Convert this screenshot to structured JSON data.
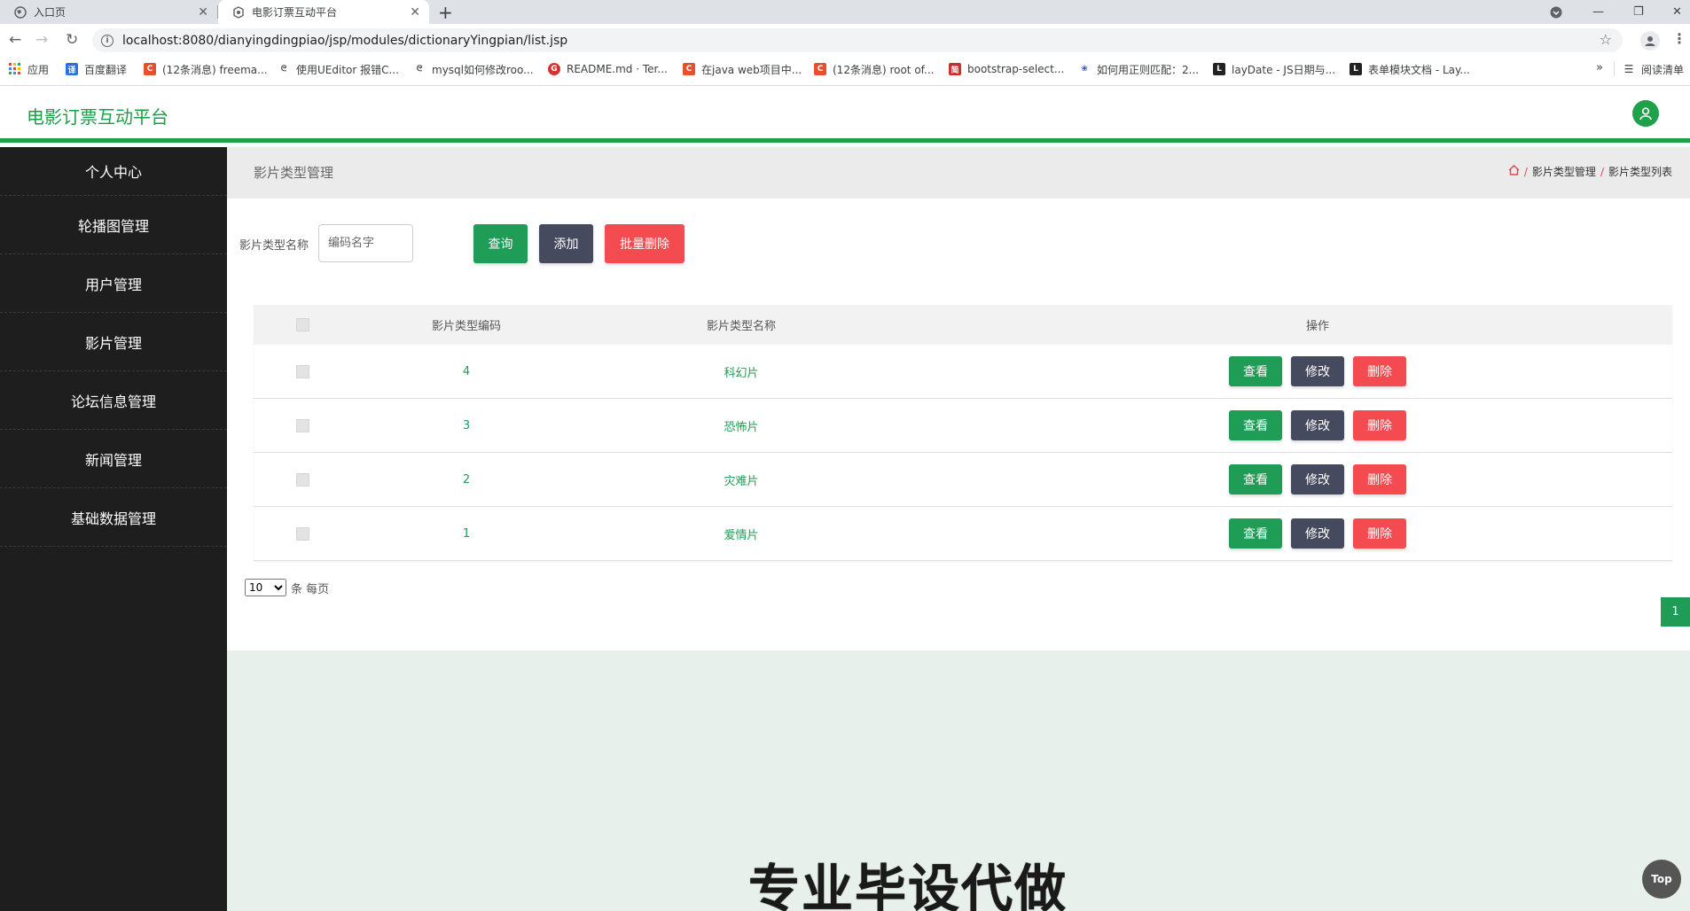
{
  "browser": {
    "tabs": [
      {
        "title": "入口页",
        "active": false
      },
      {
        "title": "电影订票互动平台",
        "active": true
      }
    ],
    "url": "localhost:8080/dianyingdingpiao/jsp/modules/dictionaryYingpian/list.jsp",
    "bookmarks": [
      {
        "label": "应用",
        "color": "#e8453c",
        "icon": "apps-grid-icon"
      },
      {
        "label": "百度翻译",
        "color": "#2b6fe0",
        "icon": "baidu-translate-icon"
      },
      {
        "label": "(12条消息) freema...",
        "color": "#e84f2c",
        "icon": "csdn-icon"
      },
      {
        "label": "使用UEditor 报错C...",
        "color": "#333333",
        "icon": "blog-icon"
      },
      {
        "label": "mysql如何修改roo...",
        "color": "#333333",
        "icon": "blog-icon"
      },
      {
        "label": "README.md · Ter...",
        "color": "#d6322f",
        "icon": "gitee-icon"
      },
      {
        "label": "在java web项目中...",
        "color": "#e84f2c",
        "icon": "csdn-icon"
      },
      {
        "label": "(12条消息) root of...",
        "color": "#e84f2c",
        "icon": "csdn-icon"
      },
      {
        "label": "bootstrap-select...",
        "color": "#c6312c",
        "icon": "jianshu-icon"
      },
      {
        "label": "如何用正则匹配：2...",
        "color": "#2e4fd6",
        "icon": "baidu-paw-icon"
      },
      {
        "label": "layDate - JS日期与...",
        "color": "#222222",
        "icon": "layui-icon"
      },
      {
        "label": "表单模块文档 - Lay...",
        "color": "#222222",
        "icon": "layui-icon"
      }
    ],
    "reading_list": "阅读清单"
  },
  "app": {
    "title": "电影订票互动平台",
    "brand_color": "#1fa14a"
  },
  "sidebar": {
    "items": [
      {
        "label": "个人中心"
      },
      {
        "label": "轮播图管理"
      },
      {
        "label": "用户管理"
      },
      {
        "label": "影片管理"
      },
      {
        "label": "论坛信息管理"
      },
      {
        "label": "新闻管理"
      },
      {
        "label": "基础数据管理"
      }
    ]
  },
  "breadcrumb": {
    "title": "影片类型管理",
    "path": [
      "影片类型管理",
      "影片类型列表"
    ]
  },
  "search": {
    "label": "影片类型名称",
    "placeholder": "编码名字",
    "value": "",
    "query_label": "查询",
    "add_label": "添加",
    "batch_delete_label": "批量删除"
  },
  "table": {
    "headers": {
      "code": "影片类型编码",
      "name": "影片类型名称",
      "ops": "操作"
    },
    "rows": [
      {
        "code": "4",
        "name": "科幻片"
      },
      {
        "code": "3",
        "name": "恐怖片"
      },
      {
        "code": "2",
        "name": "灾难片"
      },
      {
        "code": "1",
        "name": "爱情片"
      }
    ],
    "actions": {
      "view": "查看",
      "edit": "修改",
      "delete": "删除"
    }
  },
  "pagination": {
    "page_size": "10",
    "page_size_suffix": "条 每页",
    "current_page": "1"
  },
  "watermark": "专业毕设代做",
  "top_button": "Top"
}
